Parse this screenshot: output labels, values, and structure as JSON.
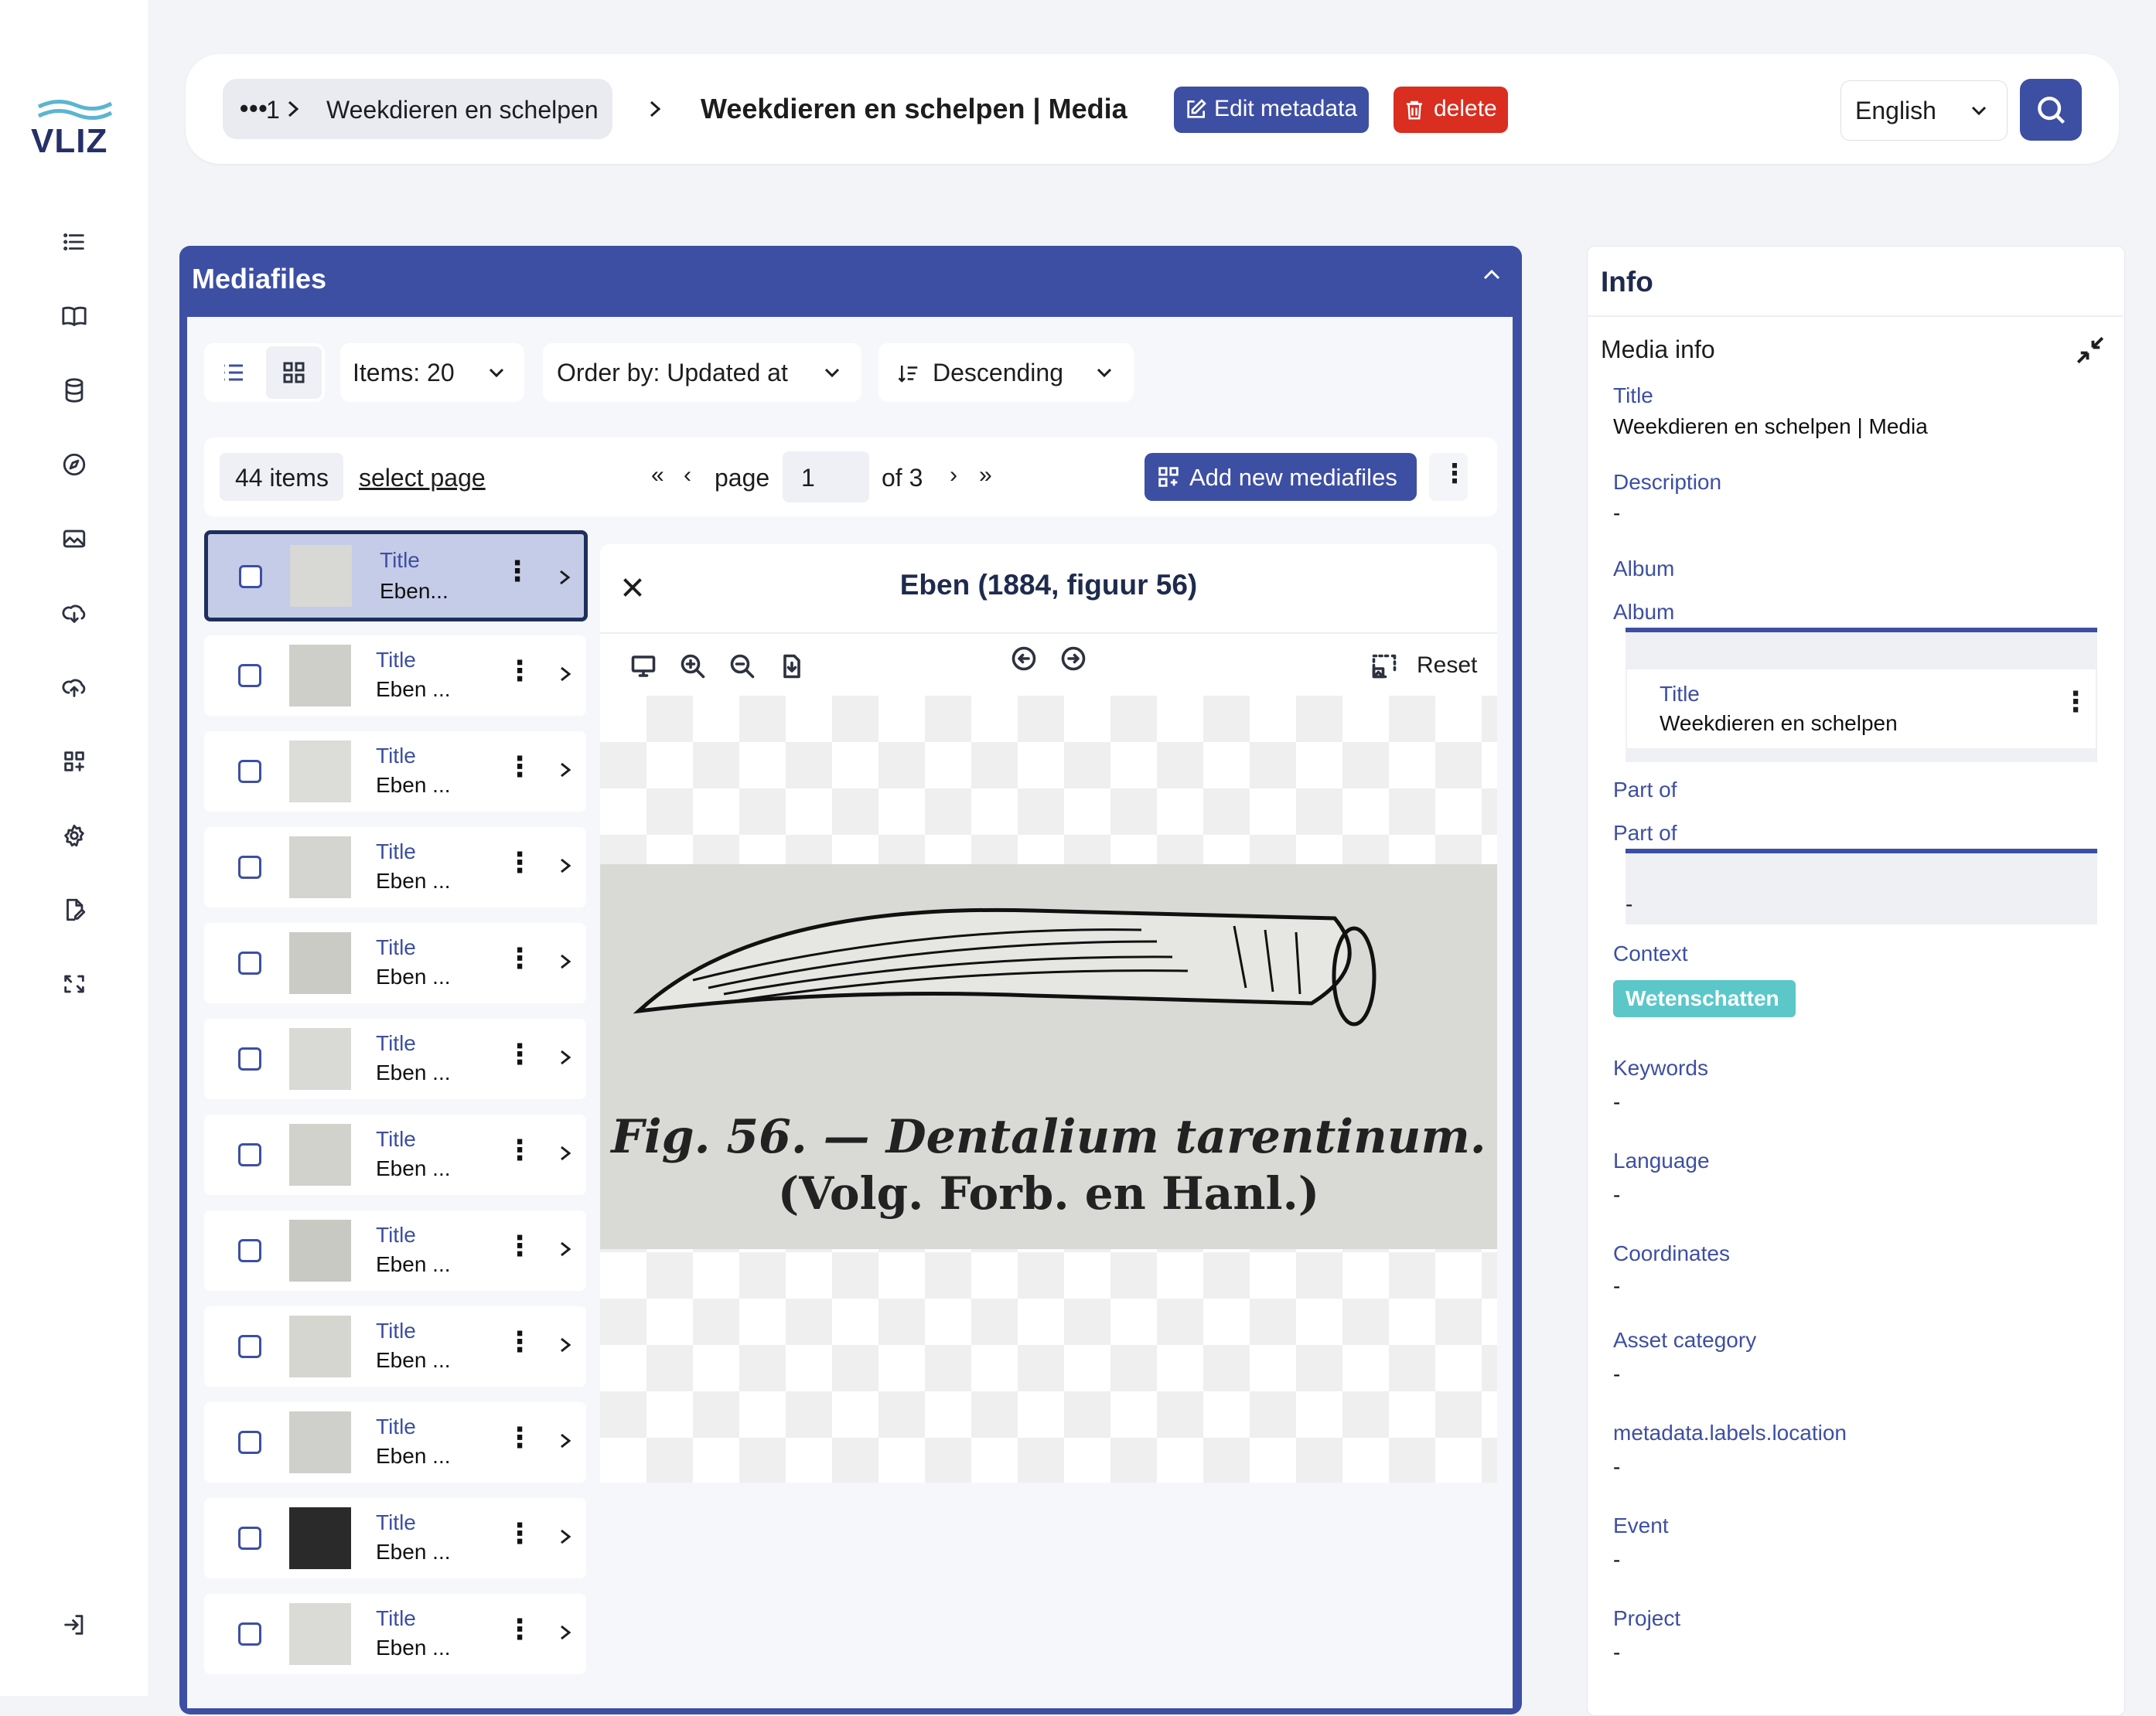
{
  "brand": {
    "logo_text": "VLIZ",
    "accent": "#3d4fa3",
    "danger": "#d92e20",
    "tag_color": "#5bc7c9"
  },
  "sidebar": {
    "icons": [
      "list-icon",
      "book-icon",
      "database-icon",
      "compass-icon",
      "image-icon",
      "cloud-download-icon",
      "cloud-upload-icon",
      "grid-plus-icon",
      "gear-icon",
      "document-edit-icon",
      "convert-icon",
      "logout-icon"
    ]
  },
  "header": {
    "crumb_dots": "•••",
    "crumb_number": "1",
    "crumb_parent": "Weekdieren en schelpen",
    "title": "Weekdieren en schelpen | Media",
    "edit_label": "Edit metadata",
    "delete_label": "delete",
    "language": "English"
  },
  "mediafiles": {
    "panel_title": "Mediafiles",
    "items_select": "Items: 20",
    "order_select": "Order by: Updated at",
    "direction_select": "Descending",
    "count_label": "44 items",
    "select_page_label": "select page",
    "page_label": "page",
    "page_value": "1",
    "of_label": "of 3",
    "add_label": "Add new mediafiles",
    "rows": [
      {
        "title_label": "Title",
        "value": "Eben..."
      },
      {
        "title_label": "Title",
        "value": "Eben ..."
      },
      {
        "title_label": "Title",
        "value": "Eben ..."
      },
      {
        "title_label": "Title",
        "value": "Eben ..."
      },
      {
        "title_label": "Title",
        "value": "Eben ..."
      },
      {
        "title_label": "Title",
        "value": "Eben ..."
      },
      {
        "title_label": "Title",
        "value": "Eben ..."
      },
      {
        "title_label": "Title",
        "value": "Eben ..."
      },
      {
        "title_label": "Title",
        "value": "Eben ..."
      },
      {
        "title_label": "Title",
        "value": "Eben ..."
      },
      {
        "title_label": "Title",
        "value": "Eben ..."
      },
      {
        "title_label": "Title",
        "value": "Eben ..."
      }
    ]
  },
  "viewer": {
    "title": "Eben (1884, figuur 56)",
    "reset_label": "Reset",
    "caption_line1": "Fig. 56. — Dentalium tarentinum.",
    "caption_line2": "(Volg. Forb. en Hanl.)"
  },
  "info": {
    "panel_title": "Info",
    "section_title": "Media info",
    "title_label": "Title",
    "title_value": "Weekdieren en schelpen | Media",
    "description_label": "Description",
    "description_value": "-",
    "album_label": "Album",
    "album_sub_label": "Album",
    "album_card_label": "Title",
    "album_card_value": "Weekdieren en schelpen",
    "partof_label": "Part of",
    "partof_sub_label": "Part of",
    "partof_value": "-",
    "context_label": "Context",
    "context_tag": "Wetenschatten",
    "keywords_label": "Keywords",
    "keywords_value": "-",
    "language_label": "Language",
    "language_value": "-",
    "coordinates_label": "Coordinates",
    "coordinates_value": "-",
    "asset_label": "Asset category",
    "asset_value": "-",
    "location_label": "metadata.labels.location",
    "location_value": "-",
    "event_label": "Event",
    "event_value": "-",
    "project_label": "Project",
    "project_value": "-"
  }
}
